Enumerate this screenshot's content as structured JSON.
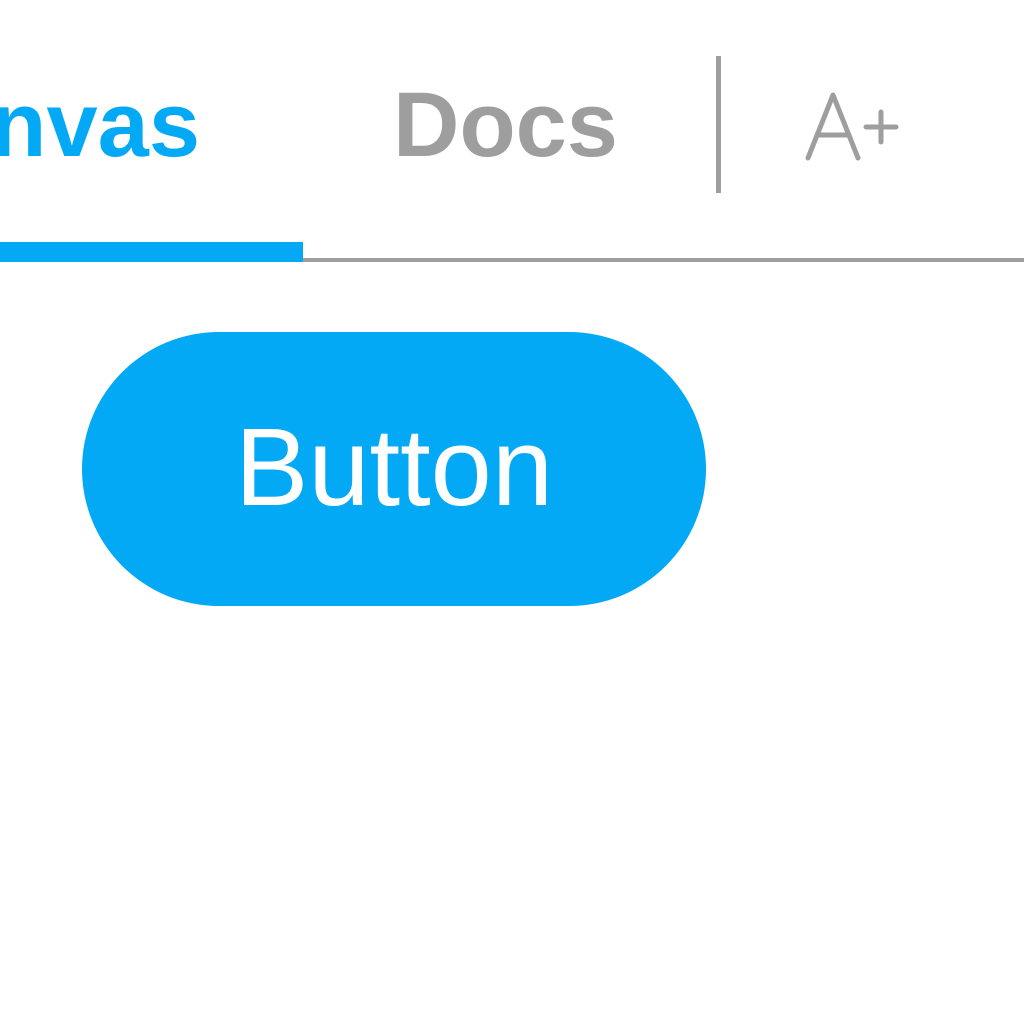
{
  "tabs": [
    {
      "label": "Canvas",
      "active": true
    },
    {
      "label": "Docs",
      "active": false
    }
  ],
  "font_size_control": {
    "icon": "font-size-increase-icon",
    "label": "A+"
  },
  "main": {
    "button_label": "Button"
  },
  "colors": {
    "accent": "#03a9f4",
    "inactive": "#9e9e9e",
    "background": "#ffffff",
    "button_text": "#ffffff"
  }
}
